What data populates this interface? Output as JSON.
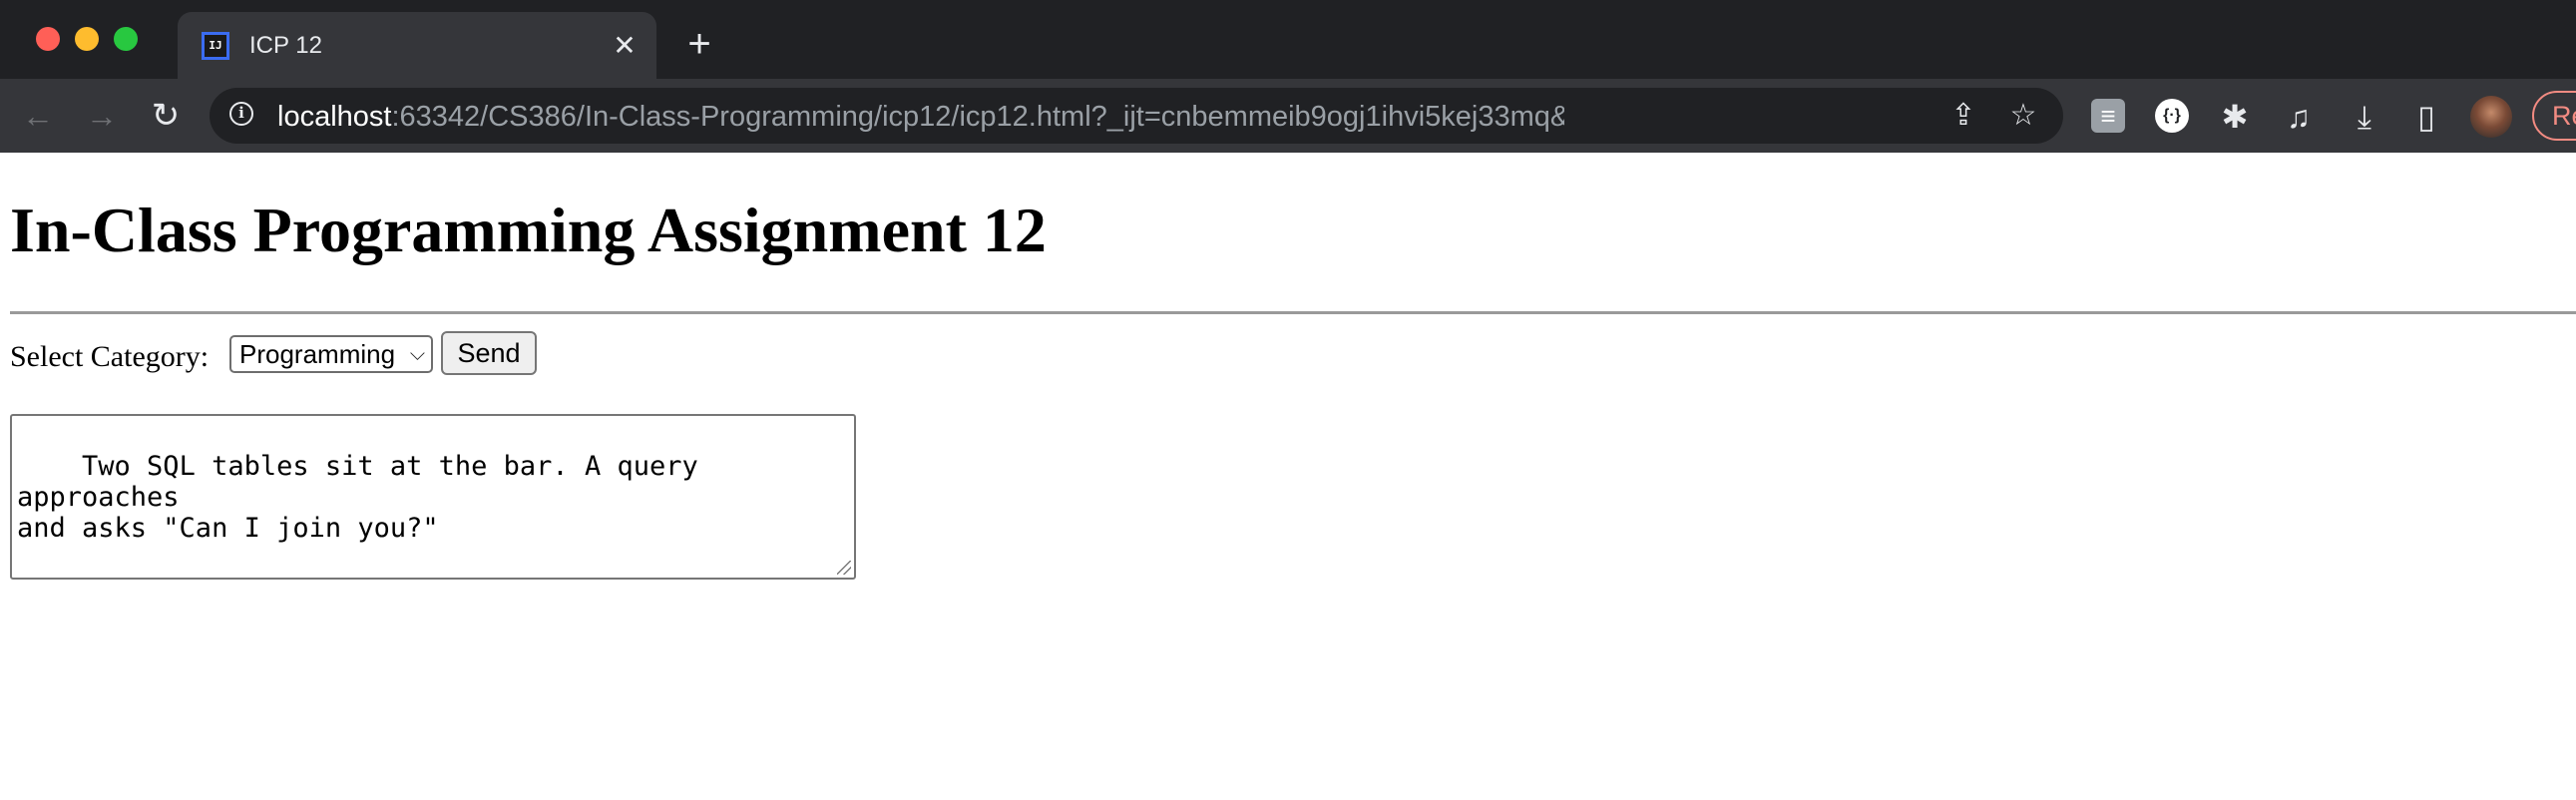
{
  "browser": {
    "tab": {
      "favicon_text": "IJ",
      "title": "ICP 12",
      "close_glyph": "✕"
    },
    "new_tab_glyph": "+",
    "toolbar": {
      "back_glyph": "←",
      "forward_glyph": "→",
      "reload_glyph": "↻",
      "info_glyph": "i",
      "url_host": "localhost",
      "url_rest": ":63342/CS386/In-Class-Programming/icp12/icp12.html?_ijt=cnbemmeib9ogj1ihvi5kej33mq&_ij_reload=RELOAD_...",
      "share_glyph": "⇪",
      "star_glyph": "☆"
    },
    "extensions": {
      "ext1_glyph": "≡",
      "ext2_glyph": "{·}",
      "puzzle_glyph": "✱",
      "media_glyph": "♫",
      "download_glyph": "⤓",
      "sidepanel_glyph": "▯"
    },
    "relaunch_label": "Relaunch"
  },
  "page": {
    "title": "In-Class Programming Assignment 12",
    "category_label": "Select Category:",
    "category_selected": "Programming",
    "chevron_glyph": "⌵",
    "send_label": "Send",
    "joke_text": "Two SQL tables sit at the bar. A query approaches\nand asks \"Can I join you?\""
  },
  "colors": {
    "chrome_dark": "#202124",
    "toolbar": "#35363a",
    "relaunch_accent": "#f28b82"
  }
}
